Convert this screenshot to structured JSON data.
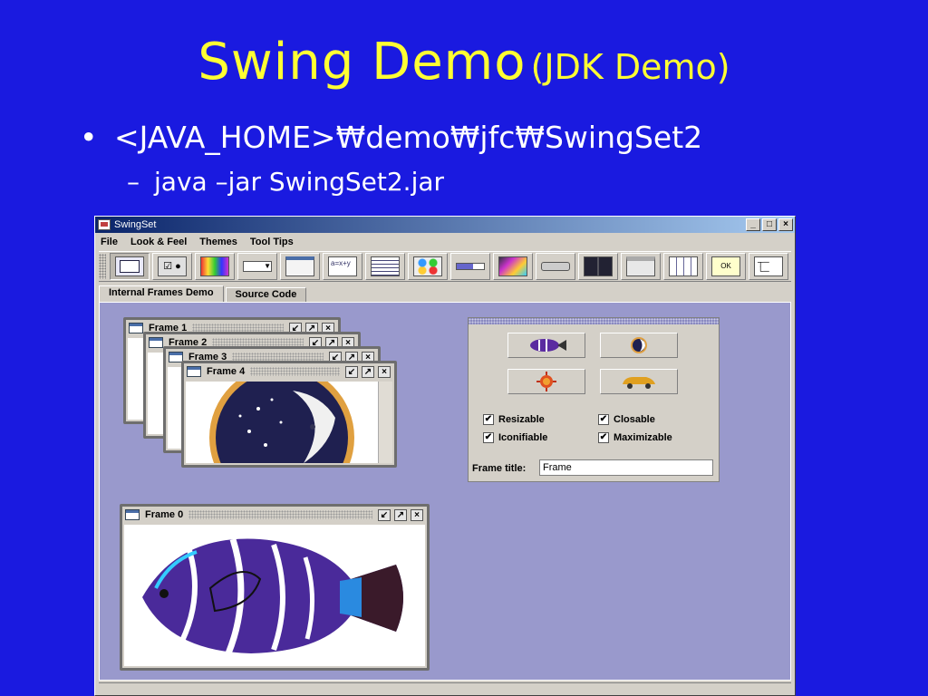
{
  "slide": {
    "title": "Swing Demo",
    "title_suffix": "(JDK Demo)",
    "bullet": "<JAVA_HOME>₩demo₩jfc₩SwingSet2",
    "subbullet": "java –jar SwingSet2.jar"
  },
  "window": {
    "title": "SwingSet",
    "menu": [
      "File",
      "Look & Feel",
      "Themes",
      "Tool Tips"
    ],
    "toolbar_icons": [
      "internal-frame-icon",
      "checkbox-radio-icon",
      "color-chooser-icon",
      "combobox-icon",
      "file-chooser-icon",
      "editor-pane-icon",
      "list-icon",
      "option-pane-icon",
      "progress-bar-icon",
      "scroll-pane-icon",
      "slider-icon",
      "split-pane-icon",
      "tabbed-pane-icon",
      "table-icon",
      "tooltip-icon",
      "tree-icon"
    ],
    "tabs": [
      "Internal Frames Demo",
      "Source Code"
    ],
    "frames": [
      "Frame 1",
      "Frame 2",
      "Frame 3",
      "Frame 4",
      "Frame 0"
    ],
    "panel": {
      "checkboxes": [
        "Resizable",
        "Closable",
        "Iconifiable",
        "Maximizable"
      ],
      "frame_title_label": "Frame title:",
      "frame_title_value": "Frame"
    },
    "colors": {
      "desktop": "#9999cc",
      "slide_bg": "#1a1ae0",
      "title": "#ffff33"
    }
  }
}
